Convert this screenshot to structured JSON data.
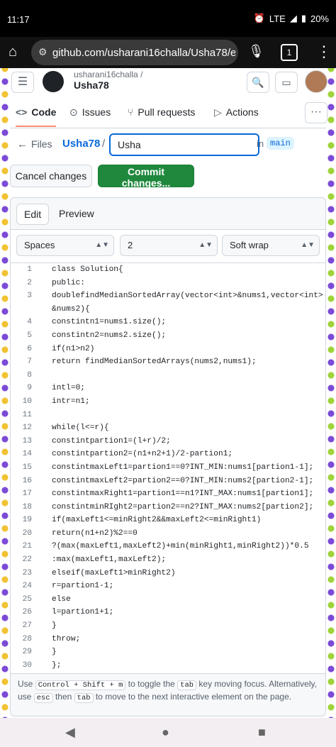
{
  "statusbar": {
    "time": "11:17",
    "battery": "20%",
    "signal": "LTE"
  },
  "browser": {
    "url": "github.com/usharani16challa/Usha78/edit/",
    "tab_count": "1"
  },
  "header": {
    "owner": "usharani16challa /",
    "repo": "Usha78"
  },
  "nav": {
    "code": "Code",
    "issues": "Issues",
    "pulls": "Pull requests",
    "actions": "Actions"
  },
  "breadcrumb": {
    "files": "Files",
    "repo": "Usha78",
    "separator": "/",
    "filename": "Usha",
    "in": "in",
    "branch": "main"
  },
  "buttons": {
    "cancel": "Cancel changes",
    "commit": "Commit changes..."
  },
  "editor": {
    "tab_edit": "Edit",
    "tab_preview": "Preview",
    "indent_mode": "Spaces",
    "indent_size": "2",
    "wrap_mode": "Soft wrap",
    "lines": [
      {
        "n": "1",
        "t": "class Solution{"
      },
      {
        "n": "2",
        "t": "public:"
      },
      {
        "n": "3",
        "t": "doublefindMedianSortedArray(vector<int>&nums1,vector<int>"
      },
      {
        "n": "",
        "t": "&nums2){"
      },
      {
        "n": "4",
        "t": "constintn1=nums1.size();"
      },
      {
        "n": "5",
        "t": "constintn2=nums2.size();"
      },
      {
        "n": "6",
        "t": "if(n1>n2)"
      },
      {
        "n": "7",
        "t": "return findMedianSortedArrays(nums2,nums1);"
      },
      {
        "n": "8",
        "t": ""
      },
      {
        "n": "9",
        "t": "intl=0;"
      },
      {
        "n": "10",
        "t": "intr=n1;"
      },
      {
        "n": "11",
        "t": ""
      },
      {
        "n": "12",
        "t": "while(l<=r){"
      },
      {
        "n": "13",
        "t": "constintpartion1=(l+r)/2;"
      },
      {
        "n": "14",
        "t": "constintpartion2=(n1+n2+1)/2-partion1;"
      },
      {
        "n": "15",
        "t": "constintmaxLeft1=partion1==0?INT_MIN:nums1[partion1-1];"
      },
      {
        "n": "16",
        "t": "constintmaxLeft2=partion2==0?INT_MIN:nums2[partion2-1];"
      },
      {
        "n": "17",
        "t": "constintmaxRight1=partion1==n1?INT_MAX:nums1[partion1];"
      },
      {
        "n": "18",
        "t": "constintminRIght2=partion2==n2?INT_MAX:nums2[partion2];"
      },
      {
        "n": "19",
        "t": "if(maxLeft1<=minRight2&&maxLeft2<=minRight1)"
      },
      {
        "n": "20",
        "t": "return(n1+n2)%2==0"
      },
      {
        "n": "21",
        "t": "?(max(maxLeft1,maxLeft2)+min(minRight1,minRight2))*0.5"
      },
      {
        "n": "22",
        "t": ":max(maxLeft1,maxLeft2);"
      },
      {
        "n": "23",
        "t": "elseif(maxLeft1>minRight2)"
      },
      {
        "n": "24",
        "t": "r=partion1-1;"
      },
      {
        "n": "25",
        "t": "else"
      },
      {
        "n": "26",
        "t": "l=partion1+1;"
      },
      {
        "n": "27",
        "t": "}"
      },
      {
        "n": "28",
        "t": "throw;"
      },
      {
        "n": "29",
        "t": "}"
      },
      {
        "n": "30",
        "t": "};"
      }
    ],
    "hint": {
      "use": "Use",
      "k1": "Control + Shift + m",
      "mid": "to toggle the",
      "k2": "tab",
      "mid2": "key moving focus. Alternatively, use",
      "k3": "esc",
      "then": "then",
      "k4": "tab",
      "end": "to move to the next interactive element on the page."
    }
  }
}
